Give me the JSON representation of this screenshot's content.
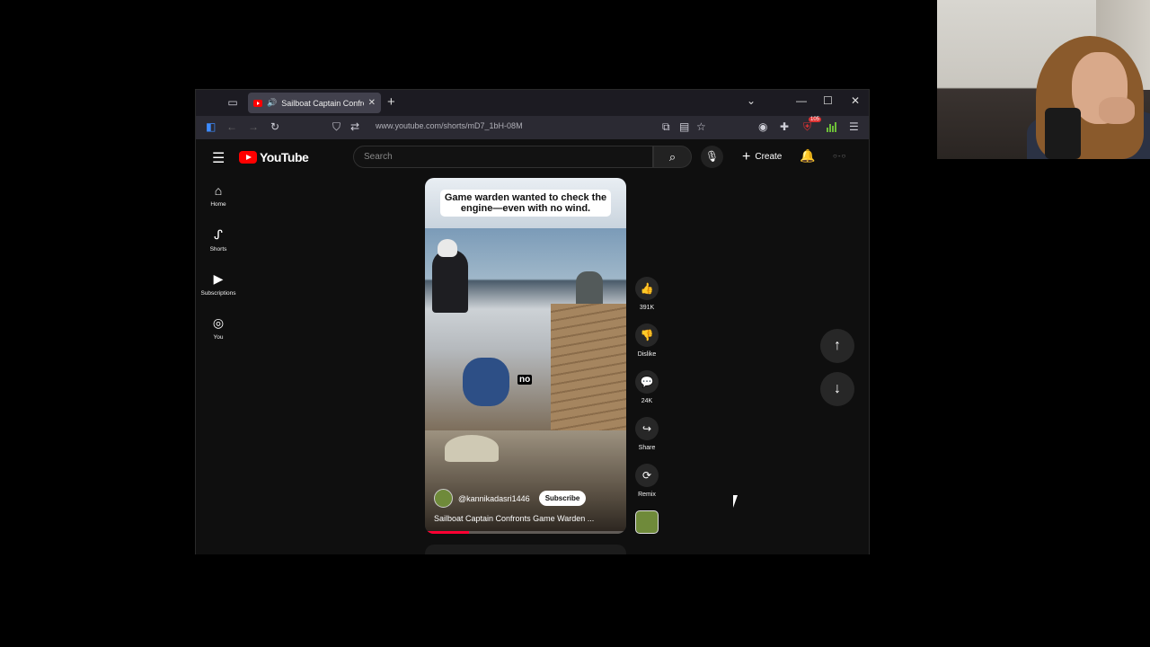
{
  "browser": {
    "tab_title": "Sailboat Captain Confronts",
    "url": "www.youtube.com/shorts/mD7_1bH-08M",
    "extension_badge": "105"
  },
  "youtube": {
    "logo_text": "YouTube",
    "search_placeholder": "Search",
    "create_label": "Create",
    "guide": [
      {
        "label": "Home",
        "icon": "home-icon"
      },
      {
        "label": "Shorts",
        "icon": "shorts-icon"
      },
      {
        "label": "Subscriptions",
        "icon": "subscriptions-icon"
      },
      {
        "label": "You",
        "icon": "you-icon"
      }
    ]
  },
  "short": {
    "caption": "Game warden wanted to check the engine—even with no wind.",
    "subtitle_word": "no",
    "channel": "@kannikadasri1446",
    "subscribe_label": "Subscribe",
    "title": "Sailboat Captain Confronts Game Warden ...",
    "progress": 0.22,
    "actions": [
      {
        "label": "391K",
        "icon": "like-icon"
      },
      {
        "label": "Dislike",
        "icon": "dislike-icon"
      },
      {
        "label": "24K",
        "icon": "comments-icon"
      },
      {
        "label": "Share",
        "icon": "share-icon"
      },
      {
        "label": "Remix",
        "icon": "remix-icon"
      }
    ]
  },
  "colors": {
    "accent": "#ff0000",
    "progress": "#ff0033"
  }
}
